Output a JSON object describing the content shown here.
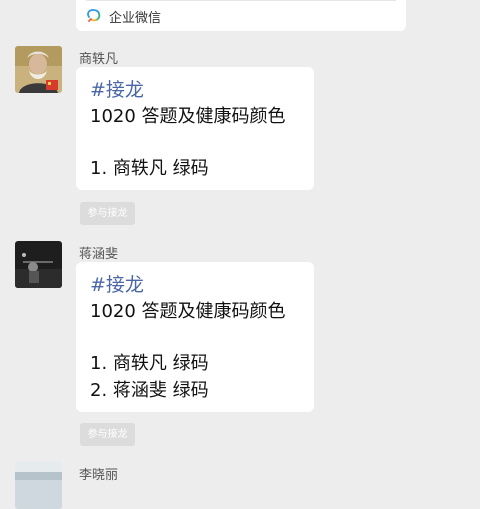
{
  "top_card": {
    "label": "企业微信",
    "icon": "wecom-icon"
  },
  "messages": [
    {
      "sender": "商轶凡",
      "tag": "#接龙",
      "title": "1020 答题及健康码颜色",
      "entries": [
        "1. 商轶凡 绿码"
      ],
      "join_label": "参与接龙"
    },
    {
      "sender": "蒋涵斐",
      "tag": "#接龙",
      "title": "1020 答题及健康码颜色",
      "entries": [
        "1. 商轶凡 绿码",
        "2. 蒋涵斐 绿码"
      ],
      "join_label": "参与接龙"
    },
    {
      "sender": "李晓丽"
    }
  ],
  "colors": {
    "background": "#ededed",
    "bubble": "#ffffff",
    "tag": "#4b67a8",
    "join_button": "#dcdcdc"
  }
}
